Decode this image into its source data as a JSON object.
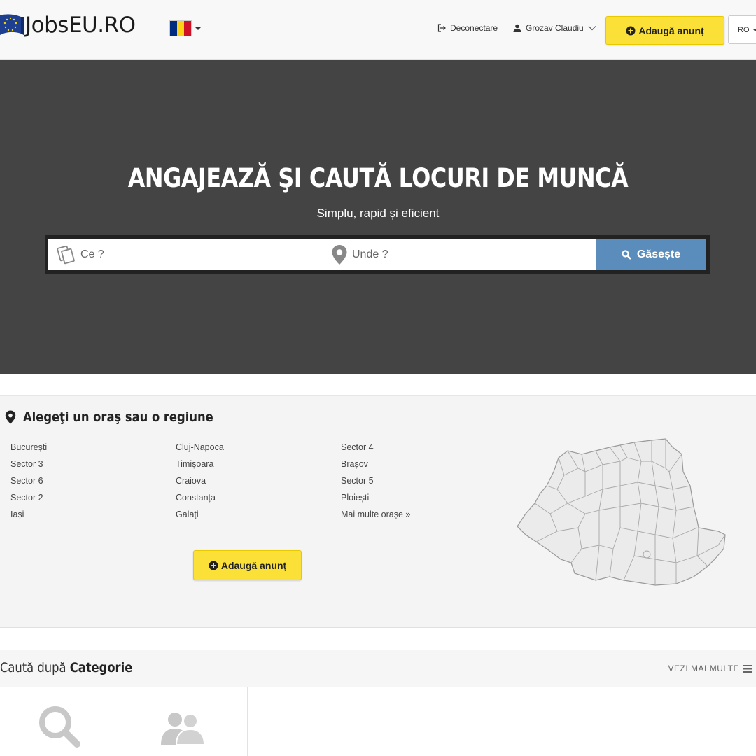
{
  "header": {
    "logo_text": "JobsEU.RO",
    "flag_colors": [
      "#002B7F",
      "#FCD116",
      "#CE1126"
    ],
    "logout_label": "Deconectare",
    "user_name": "Grozav Claudiu",
    "add_ad_label": "Adaugă anunț",
    "language": "RO"
  },
  "hero": {
    "title": "ANGAJEAZĂ ŞI CAUTĂ LOCURI DE MUNCĂ",
    "subtitle": "Simplu, rapid și eficient",
    "what_placeholder": "Ce ?",
    "where_placeholder": "Unde ?",
    "search_label": "Găsește"
  },
  "regions": {
    "title": "Alegeţi un oraş sau o regiune",
    "columns": [
      [
        "București",
        "Sector 3",
        "Sector 6",
        "Sector 2",
        "Iași"
      ],
      [
        "Cluj-Napoca",
        "Timișoara",
        "Craiova",
        "Constanța",
        "Galați"
      ],
      [
        "Sector 4",
        "Brașov",
        "Sector 5",
        "Ploiești",
        "Mai multe orașe »"
      ]
    ],
    "add_ad_label": "Adaugă anunț"
  },
  "categories": {
    "title_prefix": "Caută după",
    "title_bold": "Categorie",
    "more_label": "VEZI MAI MULTE"
  },
  "colors": {
    "accent_yellow": "#fae037",
    "search_blue": "#5a8dbb",
    "hero_bg": "#444444"
  }
}
